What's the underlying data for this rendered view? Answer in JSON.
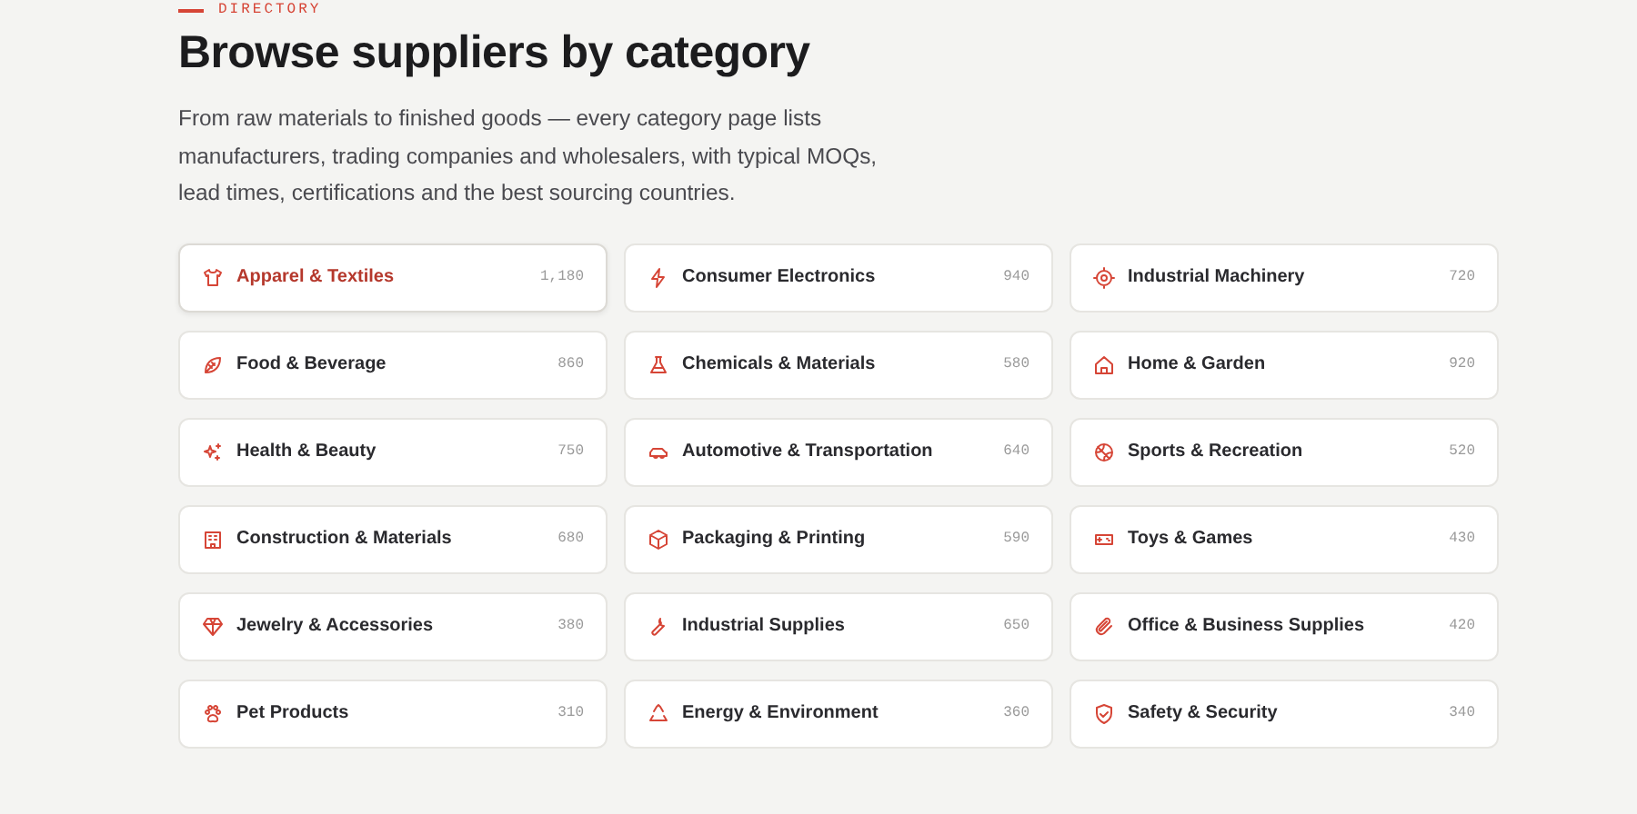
{
  "eyebrow": "DIRECTORY",
  "title": "Browse suppliers by category",
  "description": "From raw materials to finished goods — every category page lists manufacturers, trading companies and wholesalers, with typical MOQs, lead times, certifications and the best sourcing countries.",
  "categories": [
    {
      "label": "Apparel & Textiles",
      "count": "1,180",
      "selected": true
    },
    {
      "label": "Consumer Electronics",
      "count": "940",
      "selected": false
    },
    {
      "label": "Industrial Machinery",
      "count": "720",
      "selected": false
    },
    {
      "label": "Food & Beverage",
      "count": "860",
      "selected": false
    },
    {
      "label": "Chemicals & Materials",
      "count": "580",
      "selected": false
    },
    {
      "label": "Home & Garden",
      "count": "920",
      "selected": false
    },
    {
      "label": "Health & Beauty",
      "count": "750",
      "selected": false
    },
    {
      "label": "Automotive & Transportation",
      "count": "640",
      "selected": false
    },
    {
      "label": "Sports & Recreation",
      "count": "520",
      "selected": false
    },
    {
      "label": "Construction & Materials",
      "count": "680",
      "selected": false
    },
    {
      "label": "Packaging & Printing",
      "count": "590",
      "selected": false
    },
    {
      "label": "Toys & Games",
      "count": "430",
      "selected": false
    },
    {
      "label": "Jewelry & Accessories",
      "count": "380",
      "selected": false
    },
    {
      "label": "Industrial Supplies",
      "count": "650",
      "selected": false
    },
    {
      "label": "Office & Business Supplies",
      "count": "420",
      "selected": false
    },
    {
      "label": "Pet Products",
      "count": "310",
      "selected": false
    },
    {
      "label": "Energy & Environment",
      "count": "360",
      "selected": false
    },
    {
      "label": "Safety & Security",
      "count": "340",
      "selected": false
    }
  ]
}
